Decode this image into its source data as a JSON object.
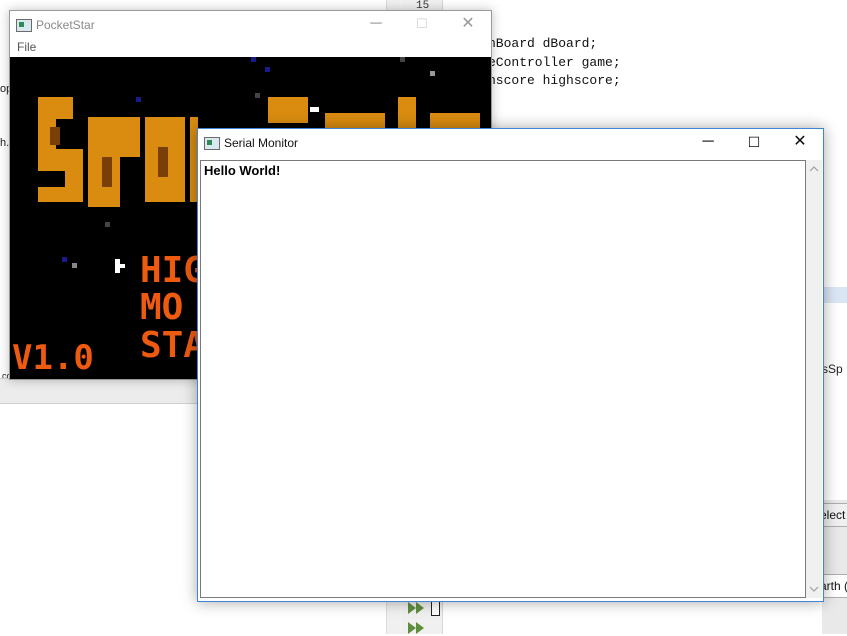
{
  "ide": {
    "gutter_line_number": "15",
    "code_lines": [
      "hBoard dBoard;",
      "eController game;",
      "nscore highscore;"
    ],
    "left_fragments": [
      "op",
      "h.",
      "con"
    ],
    "right_fragments": {
      "sspr": "sSp",
      "select": "elect",
      "earth": "arth ("
    }
  },
  "pocketstar": {
    "title": "PocketStar",
    "menu": {
      "file": "File"
    },
    "controls": {
      "minimize": "─",
      "maximize": "☐",
      "close": "✕"
    },
    "game_version": "V1.0",
    "menu_fragments": [
      "HIG",
      "MO",
      "STA"
    ]
  },
  "serial_monitor": {
    "title": "Serial Monitor",
    "controls": {
      "minimize": "─",
      "maximize": "☐",
      "close": "✕"
    },
    "output_text": "Hello World!"
  },
  "colors": {
    "serial_border": "#3f86d4",
    "game_bg": "#000000",
    "title_orange": "#d98c10",
    "text_orange": "#ee5a10"
  },
  "icons": [
    "window-icon",
    "run-arrow-icon",
    "scroll-up-icon",
    "scroll-down-icon"
  ]
}
